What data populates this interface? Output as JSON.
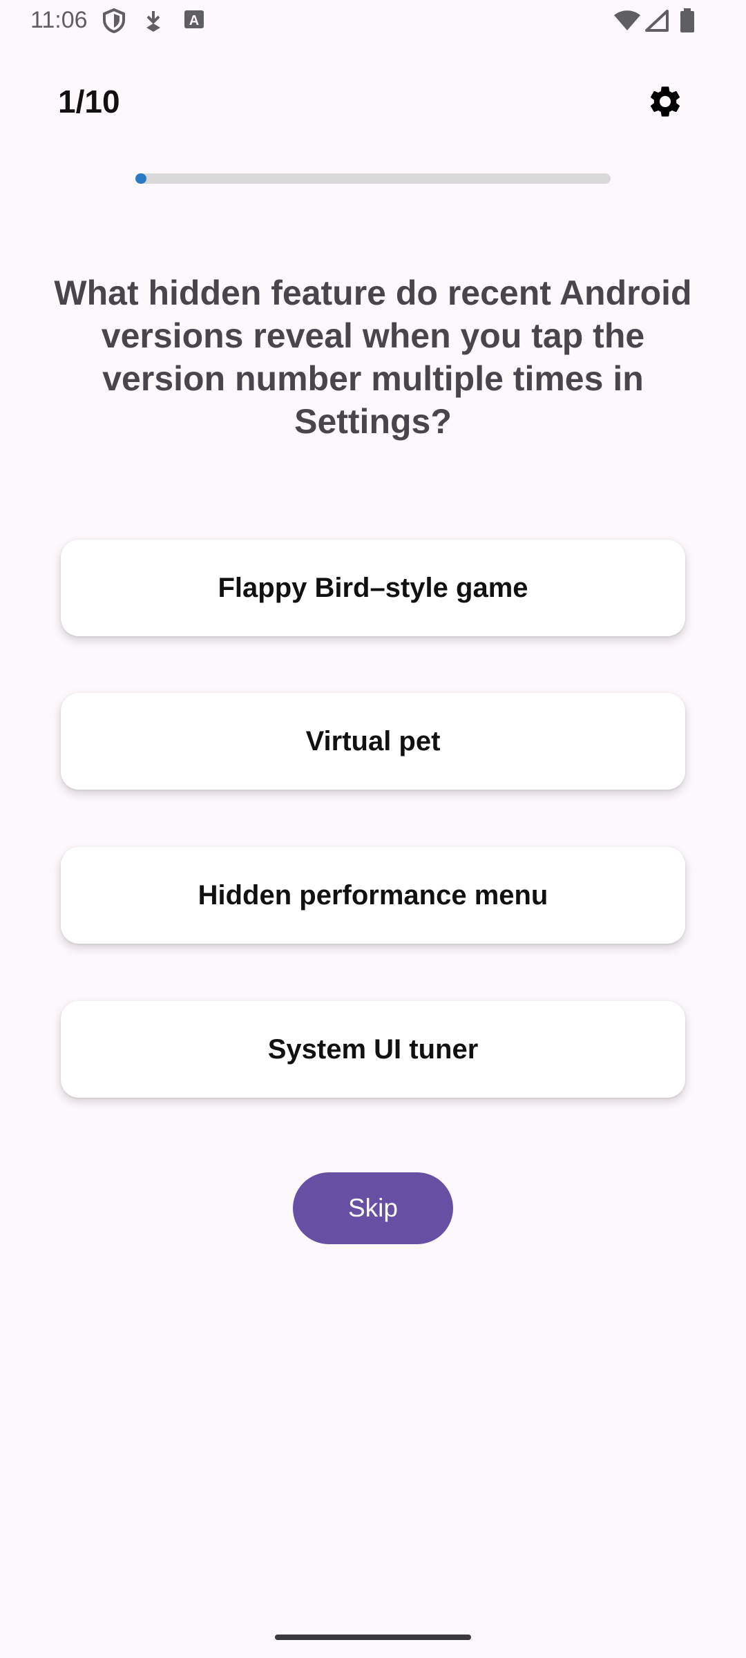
{
  "status_bar": {
    "time": "11:06",
    "left_icons": [
      "shield-icon",
      "download-icon",
      "keyboard-a-icon"
    ],
    "right_icons": [
      "wifi-icon",
      "signal-icon",
      "battery-icon"
    ]
  },
  "header": {
    "counter": "1/10",
    "settings_icon": "gear-icon"
  },
  "progress": {
    "current": 1,
    "total": 10,
    "fill_fraction": 0.02,
    "track_color": "#d9d9d9",
    "fill_color": "#2a79c4"
  },
  "question": {
    "text": "What hidden feature do recent Android versions reveal when you tap the version number multiple times in Settings?"
  },
  "answers": [
    {
      "label": "Flappy Bird–style game"
    },
    {
      "label": "Virtual pet"
    },
    {
      "label": "Hidden performance menu"
    },
    {
      "label": "System UI tuner"
    }
  ],
  "skip": {
    "label": "Skip",
    "color": "#6750a4"
  }
}
